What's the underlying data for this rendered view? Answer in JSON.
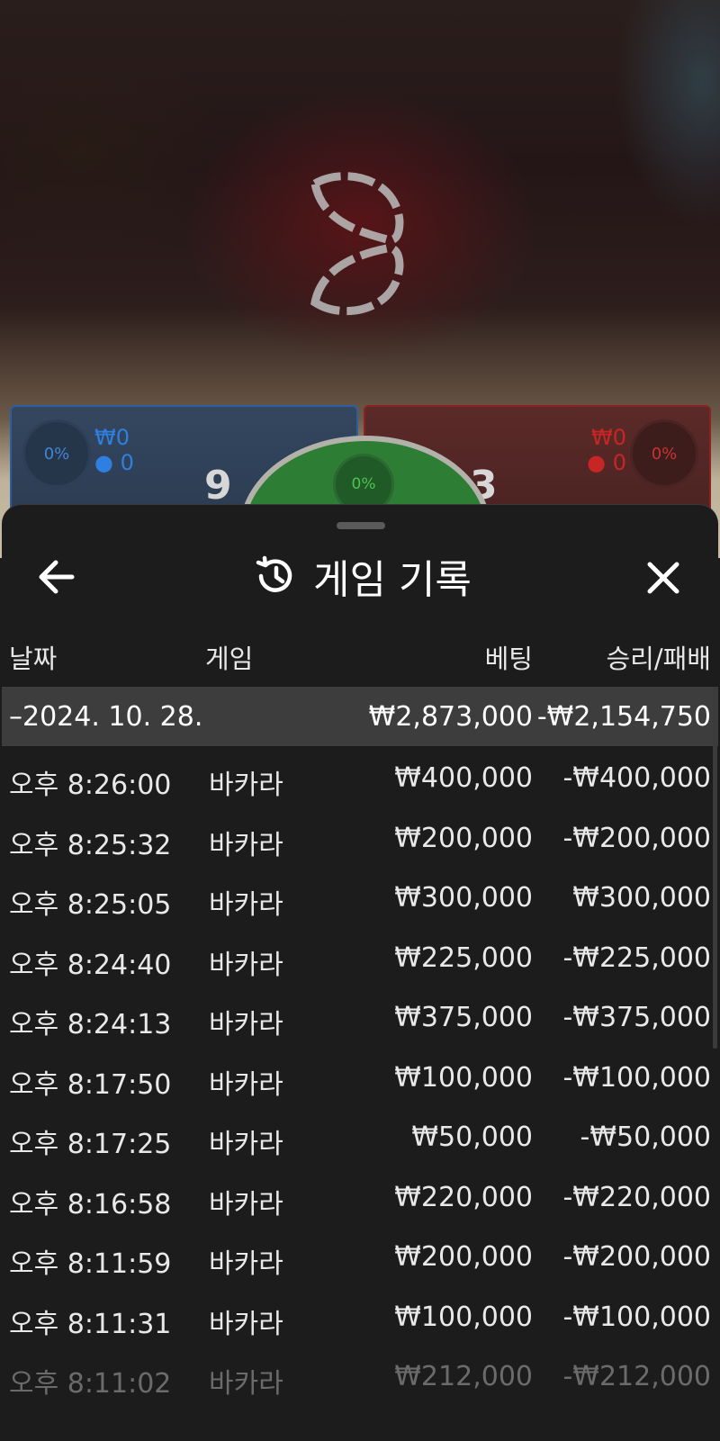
{
  "table": {
    "player": {
      "percent": "0%",
      "amount": "₩0",
      "players": "0",
      "score": "9",
      "color": "#2f7fe0"
    },
    "banker": {
      "percent": "0%",
      "amount": "₩0",
      "players": "0",
      "score": "3",
      "color": "#c82525"
    },
    "tie": {
      "percent": "0%",
      "color": "#4ec24e"
    }
  },
  "sheet": {
    "title": "게임 기록",
    "back_icon": "arrow-left-icon",
    "history_icon": "history-icon",
    "close_icon": "close-icon",
    "columns": {
      "date": "날짜",
      "game": "게임",
      "bet": "베팅",
      "win_loss": "승리/패배"
    },
    "day": {
      "date": "–2024. 10. 28.",
      "bet": "₩2,873,000",
      "win_loss": "-₩2,154,750"
    },
    "rows": [
      {
        "time": "오후 8:26:00",
        "game": "바카라",
        "bet": "₩400,000",
        "win_loss": "-₩400,000"
      },
      {
        "time": "오후 8:25:32",
        "game": "바카라",
        "bet": "₩200,000",
        "win_loss": "-₩200,000"
      },
      {
        "time": "오후 8:25:05",
        "game": "바카라",
        "bet": "₩300,000",
        "win_loss": "₩300,000"
      },
      {
        "time": "오후 8:24:40",
        "game": "바카라",
        "bet": "₩225,000",
        "win_loss": "-₩225,000"
      },
      {
        "time": "오후 8:24:13",
        "game": "바카라",
        "bet": "₩375,000",
        "win_loss": "-₩375,000"
      },
      {
        "time": "오후 8:17:50",
        "game": "바카라",
        "bet": "₩100,000",
        "win_loss": "-₩100,000"
      },
      {
        "time": "오후 8:17:25",
        "game": "바카라",
        "bet": "₩50,000",
        "win_loss": "-₩50,000"
      },
      {
        "time": "오후 8:16:58",
        "game": "바카라",
        "bet": "₩220,000",
        "win_loss": "-₩220,000"
      },
      {
        "time": "오후 8:11:59",
        "game": "바카라",
        "bet": "₩200,000",
        "win_loss": "-₩200,000"
      },
      {
        "time": "오후 8:11:31",
        "game": "바카라",
        "bet": "₩100,000",
        "win_loss": "-₩100,000"
      },
      {
        "time": "오후 8:11:02",
        "game": "바카라",
        "bet": "₩212,000",
        "win_loss": "-₩212,000"
      }
    ]
  }
}
